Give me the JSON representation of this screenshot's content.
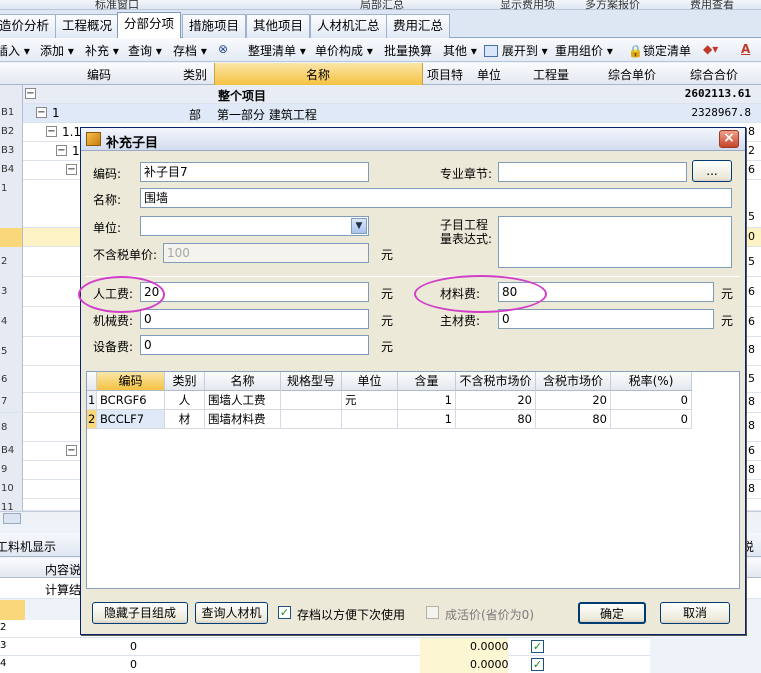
{
  "top_strip": {
    "items": [
      "标准窗口",
      "局部汇总",
      "显示费用项",
      "多方案报价",
      "费用查看"
    ]
  },
  "main_tabs": [
    "造价分析",
    "工程概况",
    "分部分项",
    "措施项目",
    "其他项目",
    "人材机汇总",
    "费用汇总"
  ],
  "active_tab": "分部分项",
  "toolbar": [
    "插入",
    "添加",
    "补充",
    "查询",
    "存档",
    "整理清单",
    "单价构成",
    "批量换算",
    "其他",
    "展开到",
    "重用组价",
    "锁定清单"
  ],
  "grid_headers": {
    "code": "编码",
    "type": "类别",
    "name": "名称",
    "feature": "项目特",
    "unit": "单位",
    "qty": "工程量",
    "unit_price": "综合单价",
    "total": "综合合价"
  },
  "grid_rows": [
    {
      "rownum": "",
      "code": "",
      "type": "",
      "name": "整个项目",
      "total": "2602113.61"
    },
    {
      "rownum": "B1",
      "code": "1",
      "type": "部",
      "name": "第一部分  建筑工程",
      "total": "2328967.8"
    },
    {
      "rownum": "B2",
      "code": "1.1",
      "type": "",
      "name": "",
      "total": "8"
    },
    {
      "rownum": "B3",
      "code": "1",
      "type": "",
      "name": "",
      "total": "2"
    },
    {
      "rownum": "B4",
      "code": "",
      "type": "",
      "name": "",
      "total": "6"
    },
    {
      "rownum": "1",
      "code": "",
      "type": "",
      "name": "",
      "total": "5"
    },
    {
      "rownum": "",
      "code": "",
      "type": "",
      "name": "",
      "total": "0"
    },
    {
      "rownum": "2",
      "code": "",
      "type": "",
      "name": "",
      "total": "5"
    },
    {
      "rownum": "3",
      "code": "",
      "type": "",
      "name": "",
      "total": "6"
    },
    {
      "rownum": "4",
      "code": "",
      "type": "",
      "name": "",
      "total": "6"
    },
    {
      "rownum": "5",
      "code": "",
      "type": "",
      "name": "",
      "total": "8"
    },
    {
      "rownum": "6",
      "code": "",
      "type": "",
      "name": "",
      "total": "5"
    },
    {
      "rownum": "7",
      "code": "",
      "type": "",
      "name": "",
      "total": "8"
    },
    {
      "rownum": "8",
      "code": "",
      "type": "",
      "name": "",
      "total": "8"
    },
    {
      "rownum": "B4",
      "code": "",
      "type": "",
      "name": "",
      "total": "6"
    },
    {
      "rownum": "9",
      "code": "",
      "type": "",
      "name": "",
      "total": "8"
    },
    {
      "rownum": "10",
      "code": "",
      "type": "",
      "name": "",
      "total": "8"
    },
    {
      "rownum": "11",
      "code": "",
      "type": "",
      "name": "",
      "total": "5"
    }
  ],
  "bottom_panel": {
    "tab": "工料机显示",
    "right_label": "说明",
    "col_content": "内容说",
    "row_calc": "计算结",
    "rows": [
      {
        "n": "2",
        "a": "",
        "b": "",
        "c": "",
        "checked": false
      },
      {
        "n": "3",
        "a": "0",
        "b": "0.0000",
        "c": "",
        "checked": true
      },
      {
        "n": "4",
        "a": "0",
        "b": "0.0000",
        "c": "",
        "checked": true
      }
    ]
  },
  "dialog": {
    "title": "补充子目",
    "close": "×",
    "code_label": "编码:",
    "code_value": "补子目7",
    "chapter_label": "专业章节:",
    "chapter_value": "",
    "browse": "...",
    "name_label": "名称:",
    "name_value": "围墙",
    "unit_label": "单位:",
    "unit_value": "",
    "qty_expr_label_1": "子目工程",
    "qty_expr_label_2": "量表达式:",
    "qty_expr_value": "",
    "price_label": "不含税单价:",
    "price_value": "100",
    "labor_label": "人工费:",
    "labor_value": "20",
    "material_label": "材料费:",
    "material_value": "80",
    "machine_label": "机械费:",
    "machine_value": "0",
    "main_material_label": "主材费:",
    "main_material_value": "0",
    "equipment_label": "设备费:",
    "equipment_value": "0",
    "unit_yuan": "元",
    "table_headers": [
      "编码",
      "类别",
      "名称",
      "规格型号",
      "单位",
      "含量",
      "不含税市场价",
      "含税市场价",
      "税率(%)"
    ],
    "table_rows": [
      {
        "n": "1",
        "code": "BCRGF6",
        "type": "人",
        "name": "围墙人工费",
        "spec": "",
        "unit": "元",
        "qty": "1",
        "price_ex": "20",
        "price_in": "20",
        "tax": "0"
      },
      {
        "n": "2",
        "code": "BCCLF7",
        "type": "材",
        "name": "围墙材料费",
        "spec": "",
        "unit": "",
        "qty": "1",
        "price_ex": "80",
        "price_in": "80",
        "tax": "0"
      }
    ],
    "hide_btn": "隐藏子目组成",
    "query_btn": "查询人材机",
    "save_chk_label": "存档以方便下次使用",
    "save_checked": true,
    "mat_price_label": "成活价(省价为0)",
    "mat_price_checked": false,
    "ok": "确定",
    "cancel": "取消"
  },
  "colors": {
    "accent": "#d23ec9",
    "title_bg": "#d3dcee",
    "header_yellow": "#f5c242"
  }
}
